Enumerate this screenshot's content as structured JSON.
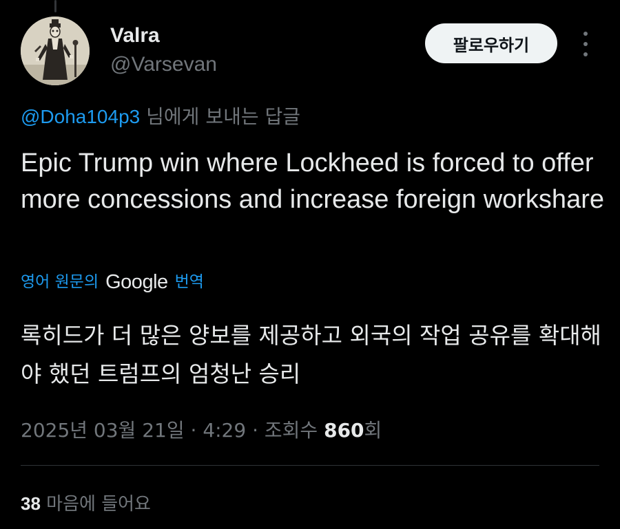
{
  "user": {
    "display_name": "Valra",
    "handle": "@Varsevan"
  },
  "actions": {
    "follow_label": "팔로우하기"
  },
  "reply": {
    "mention": "@Doha104p3",
    "suffix": " 님에게 보내는 답글"
  },
  "tweet": {
    "text": "Epic Trump win where Lockheed is forced to offer more concessions and increase foreign workshare"
  },
  "translation": {
    "label_before": "영어 원문의",
    "provider": "Google",
    "label_after": "번역",
    "text": "록히드가 더 많은 양보를 제공하고 외국의 작업 공유를 확대해야 했던 트럼프의 엄청난 승리"
  },
  "meta": {
    "date": "2025년 03월 21일",
    "separator": " · ",
    "time": "4:29",
    "views_label": "조회수 ",
    "views_count": "860",
    "views_suffix": "회"
  },
  "stats": {
    "likes_count": "38",
    "likes_label": " 마음에 들어요"
  },
  "colors": {
    "background": "#000000",
    "text_primary": "#e7e9ea",
    "text_secondary": "#71767b",
    "accent": "#1d9bf0",
    "follow_bg": "#eff3f4",
    "divider": "#2f3336"
  }
}
